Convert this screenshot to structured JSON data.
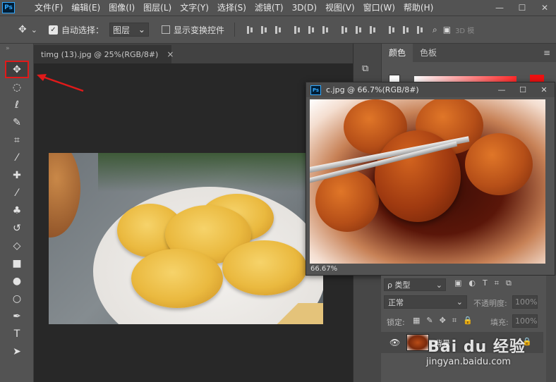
{
  "app": {
    "logo": "Ps"
  },
  "menubar": {
    "items": [
      "文件(F)",
      "编辑(E)",
      "图像(I)",
      "图层(L)",
      "文字(Y)",
      "选择(S)",
      "滤镜(T)",
      "3D(D)",
      "视图(V)",
      "窗口(W)",
      "帮助(H)"
    ],
    "window_controls": [
      "—",
      "☐",
      "✕"
    ]
  },
  "optbar": {
    "move_icon": "✥",
    "dropdown_arrow": "⌄",
    "auto_select_label": "自动选择：",
    "auto_select_checked": true,
    "layer_select_value": "图层",
    "transform_label": "显示变换控件",
    "transform_checked": false,
    "mode_3d_label": "3D 模"
  },
  "toolbar": {
    "grip": "»",
    "tools": [
      {
        "name": "move-tool",
        "glyph": "✥",
        "active": true
      },
      {
        "name": "marquee-tool",
        "glyph": "◌",
        "active": false
      },
      {
        "name": "lasso-tool",
        "glyph": "ℓ",
        "active": false
      },
      {
        "name": "quick-select-tool",
        "glyph": "✎",
        "active": false
      },
      {
        "name": "crop-tool",
        "glyph": "⌗",
        "active": false
      },
      {
        "name": "eyedropper-tool",
        "glyph": "⁄",
        "active": false
      },
      {
        "name": "healing-tool",
        "glyph": "✚",
        "active": false
      },
      {
        "name": "brush-tool",
        "glyph": "⁄",
        "active": false
      },
      {
        "name": "clone-stamp-tool",
        "glyph": "♣",
        "active": false
      },
      {
        "name": "history-brush-tool",
        "glyph": "↺",
        "active": false
      },
      {
        "name": "eraser-tool",
        "glyph": "◇",
        "active": false
      },
      {
        "name": "gradient-tool",
        "glyph": "■",
        "active": false
      },
      {
        "name": "blur-tool",
        "glyph": "●",
        "active": false
      },
      {
        "name": "dodge-tool",
        "glyph": "○",
        "active": false
      },
      {
        "name": "pen-tool",
        "glyph": "✒",
        "active": false
      },
      {
        "name": "type-tool",
        "glyph": "T",
        "active": false
      },
      {
        "name": "path-select-tool",
        "glyph": "➤",
        "active": false
      }
    ]
  },
  "document": {
    "tab_title": "timg (13).jpg @ 25%(RGB/8#)",
    "tab_close": "×"
  },
  "float_window": {
    "logo": "Ps",
    "title": "c.jpg @ 66.7%(RGB/8#)",
    "controls": [
      "—",
      "☐",
      "✕"
    ],
    "zoom_status": "66.67%"
  },
  "right_panel": {
    "history_icon": "⧉",
    "tabs": [
      "颜色",
      "色板"
    ],
    "active_tab": 0,
    "menu_icon": "≡"
  },
  "layers": {
    "filter_value": "ρ 类型",
    "filter_arrow": "⌄",
    "filter_icons": [
      "▣",
      "◐",
      "T",
      "⌗",
      "⧉"
    ],
    "blend_mode": "正常",
    "blend_arrow": "⌄",
    "opacity_label": "不透明度:",
    "opacity_value": "100%",
    "lock_label": "锁定:",
    "lock_icons": [
      "▦",
      "✎",
      "✥",
      "⌗",
      "🔒"
    ],
    "fill_label": "填充:",
    "fill_value": "100%",
    "row": {
      "eye": "👁",
      "name": "背景",
      "lock": "🔒"
    }
  },
  "watermark": {
    "logo": "Bai du 经验",
    "url": "jingyan.baidu.com"
  },
  "colors": {
    "accent_red": "#e01a1a",
    "ps_blue": "#31a8ff"
  }
}
